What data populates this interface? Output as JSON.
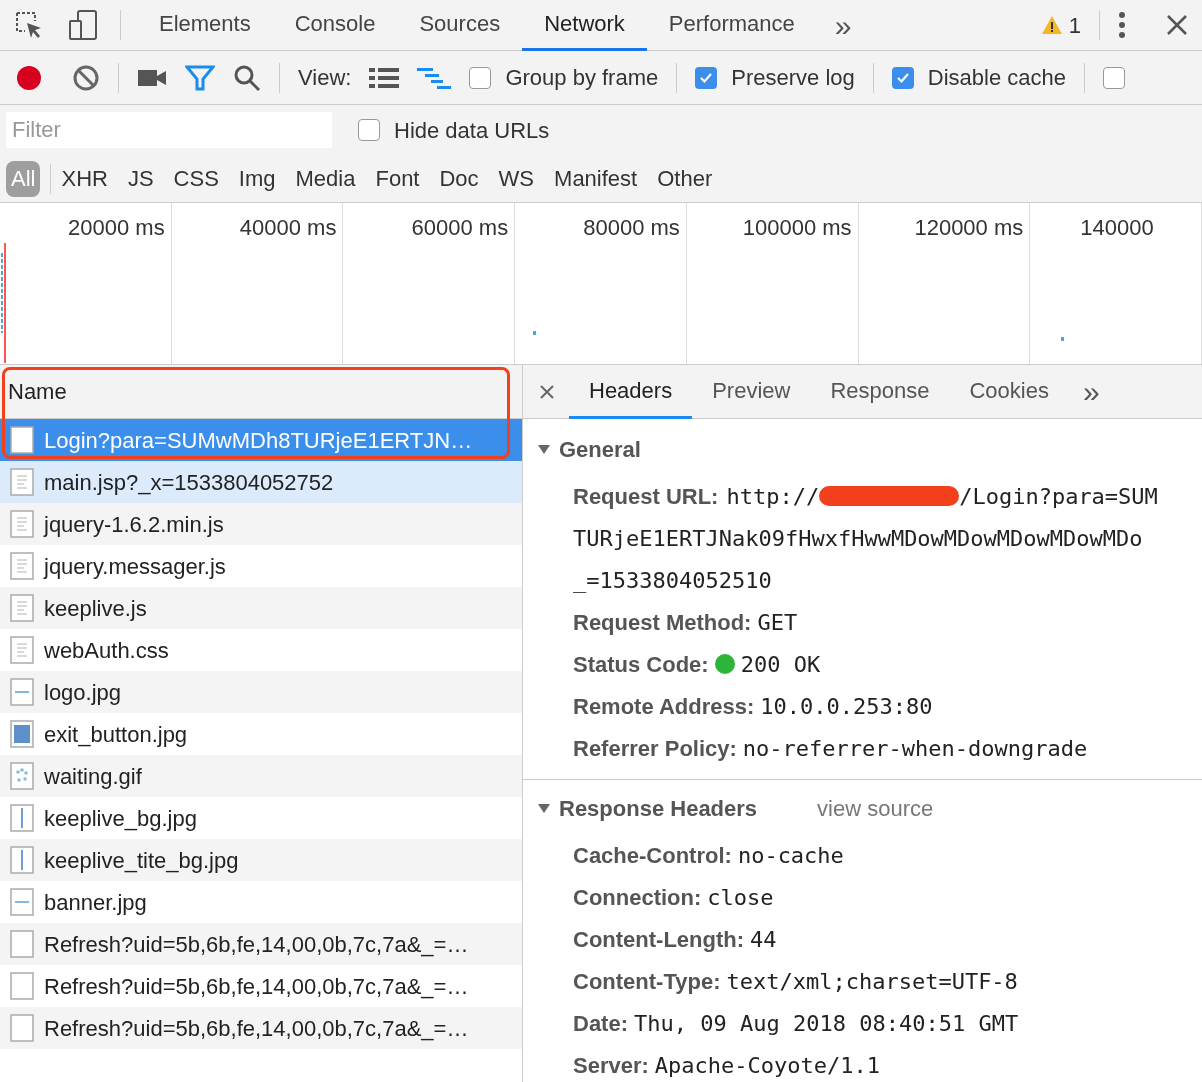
{
  "main_tabs": [
    {
      "label": "Elements",
      "selected": false
    },
    {
      "label": "Console",
      "selected": false
    },
    {
      "label": "Sources",
      "selected": false
    },
    {
      "label": "Network",
      "selected": true
    },
    {
      "label": "Performance",
      "selected": false
    }
  ],
  "more_tabs": "»",
  "warnings": {
    "count": "1"
  },
  "toolbar": {
    "recording": true,
    "filter_active": true,
    "view_label": "View:",
    "view_buttons": [
      {
        "kind": "list",
        "selected": false
      },
      {
        "kind": "waterfall",
        "selected": true
      }
    ],
    "checkboxes": [
      {
        "label": "Group by frame",
        "checked": false
      },
      {
        "label": "Preserve log",
        "checked": true
      },
      {
        "label": "Disable cache",
        "checked": true
      }
    ],
    "extra_checkbox": {
      "checked": false
    }
  },
  "filter": {
    "placeholder": "Filter",
    "hide_data_urls": {
      "label": "Hide data URLs",
      "checked": false
    }
  },
  "type_filters": [
    {
      "label": "All",
      "selected": true
    },
    {
      "label": "XHR",
      "selected": false
    },
    {
      "label": "JS",
      "selected": false
    },
    {
      "label": "CSS",
      "selected": false
    },
    {
      "label": "Img",
      "selected": false
    },
    {
      "label": "Media",
      "selected": false
    },
    {
      "label": "Font",
      "selected": false
    },
    {
      "label": "Doc",
      "selected": false
    },
    {
      "label": "WS",
      "selected": false
    },
    {
      "label": "Manifest",
      "selected": false
    },
    {
      "label": "Other",
      "selected": false
    }
  ],
  "timeline": {
    "ticks": [
      "20000 ms",
      "40000 ms",
      "60000 ms",
      "80000 ms",
      "100000 ms",
      "120000 ms",
      "140000"
    ]
  },
  "requests": {
    "column": "Name",
    "rows": [
      {
        "name": "Login?para=SUMwMDh8TURjeE1ERTJN…",
        "kind": "blank",
        "selected": true,
        "hovered": false
      },
      {
        "name": "main.jsp?_x=1533804052752",
        "kind": "document",
        "selected": false,
        "hovered": true
      },
      {
        "name": "jquery-1.6.2.min.js",
        "kind": "document",
        "selected": false,
        "hovered": false
      },
      {
        "name": "jquery.messager.js",
        "kind": "document",
        "selected": false,
        "hovered": false
      },
      {
        "name": "keeplive.js",
        "kind": "document",
        "selected": false,
        "hovered": false
      },
      {
        "name": "webAuth.css",
        "kind": "document",
        "selected": false,
        "hovered": false
      },
      {
        "name": "logo.jpg",
        "kind": "hline",
        "selected": false,
        "hovered": false
      },
      {
        "name": "exit_button.jpg",
        "kind": "photo",
        "selected": false,
        "hovered": false
      },
      {
        "name": "waiting.gif",
        "kind": "spinner",
        "selected": false,
        "hovered": false
      },
      {
        "name": "keeplive_bg.jpg",
        "kind": "vline",
        "selected": false,
        "hovered": false
      },
      {
        "name": "keeplive_tite_bg.jpg",
        "kind": "vline",
        "selected": false,
        "hovered": false
      },
      {
        "name": "banner.jpg",
        "kind": "hline",
        "selected": false,
        "hovered": false
      },
      {
        "name": "Refresh?uid=5b,6b,fe,14,00,0b,7c,7a&_=…",
        "kind": "blank",
        "selected": false,
        "hovered": false
      },
      {
        "name": "Refresh?uid=5b,6b,fe,14,00,0b,7c,7a&_=…",
        "kind": "blank",
        "selected": false,
        "hovered": false
      },
      {
        "name": "Refresh?uid=5b,6b,fe,14,00,0b,7c,7a&_=…",
        "kind": "blank",
        "selected": false,
        "hovered": false
      }
    ]
  },
  "detail_tabs": [
    {
      "label": "Headers",
      "selected": true
    },
    {
      "label": "Preview",
      "selected": false
    },
    {
      "label": "Response",
      "selected": false
    },
    {
      "label": "Cookies",
      "selected": false
    }
  ],
  "detail_more": "»",
  "general": {
    "title": "General",
    "expanded": true,
    "request_url": {
      "label": "Request URL:",
      "prefix": "http://",
      "suffix": "/Login?para=SUM",
      "lines": [
        "TURjeE1ERTJNak09fHwxfHwwMDowMDowMDowMDowMDo",
        "_=1533804052510"
      ]
    },
    "fields": [
      {
        "label": "Request Method:",
        "value": "GET"
      },
      {
        "label": "Status Code:",
        "value": "200 OK",
        "color": "#2fb43a"
      },
      {
        "label": "Remote Address:",
        "value": "10.0.0.253:80"
      },
      {
        "label": "Referrer Policy:",
        "value": "no-referrer-when-downgrade"
      }
    ]
  },
  "response_headers": {
    "title": "Response Headers",
    "expanded": true,
    "link": "view source",
    "fields": [
      {
        "label": "Cache-Control:",
        "value": "no-cache"
      },
      {
        "label": "Connection:",
        "value": "close"
      },
      {
        "label": "Content-Length:",
        "value": "44"
      },
      {
        "label": "Content-Type:",
        "value": "text/xml;charset=UTF-8"
      },
      {
        "label": "Date:",
        "value": "Thu, 09 Aug 2018 08:40:51 GMT"
      },
      {
        "label": "Server:",
        "value": "Apache-Coyote/1.1"
      }
    ]
  }
}
